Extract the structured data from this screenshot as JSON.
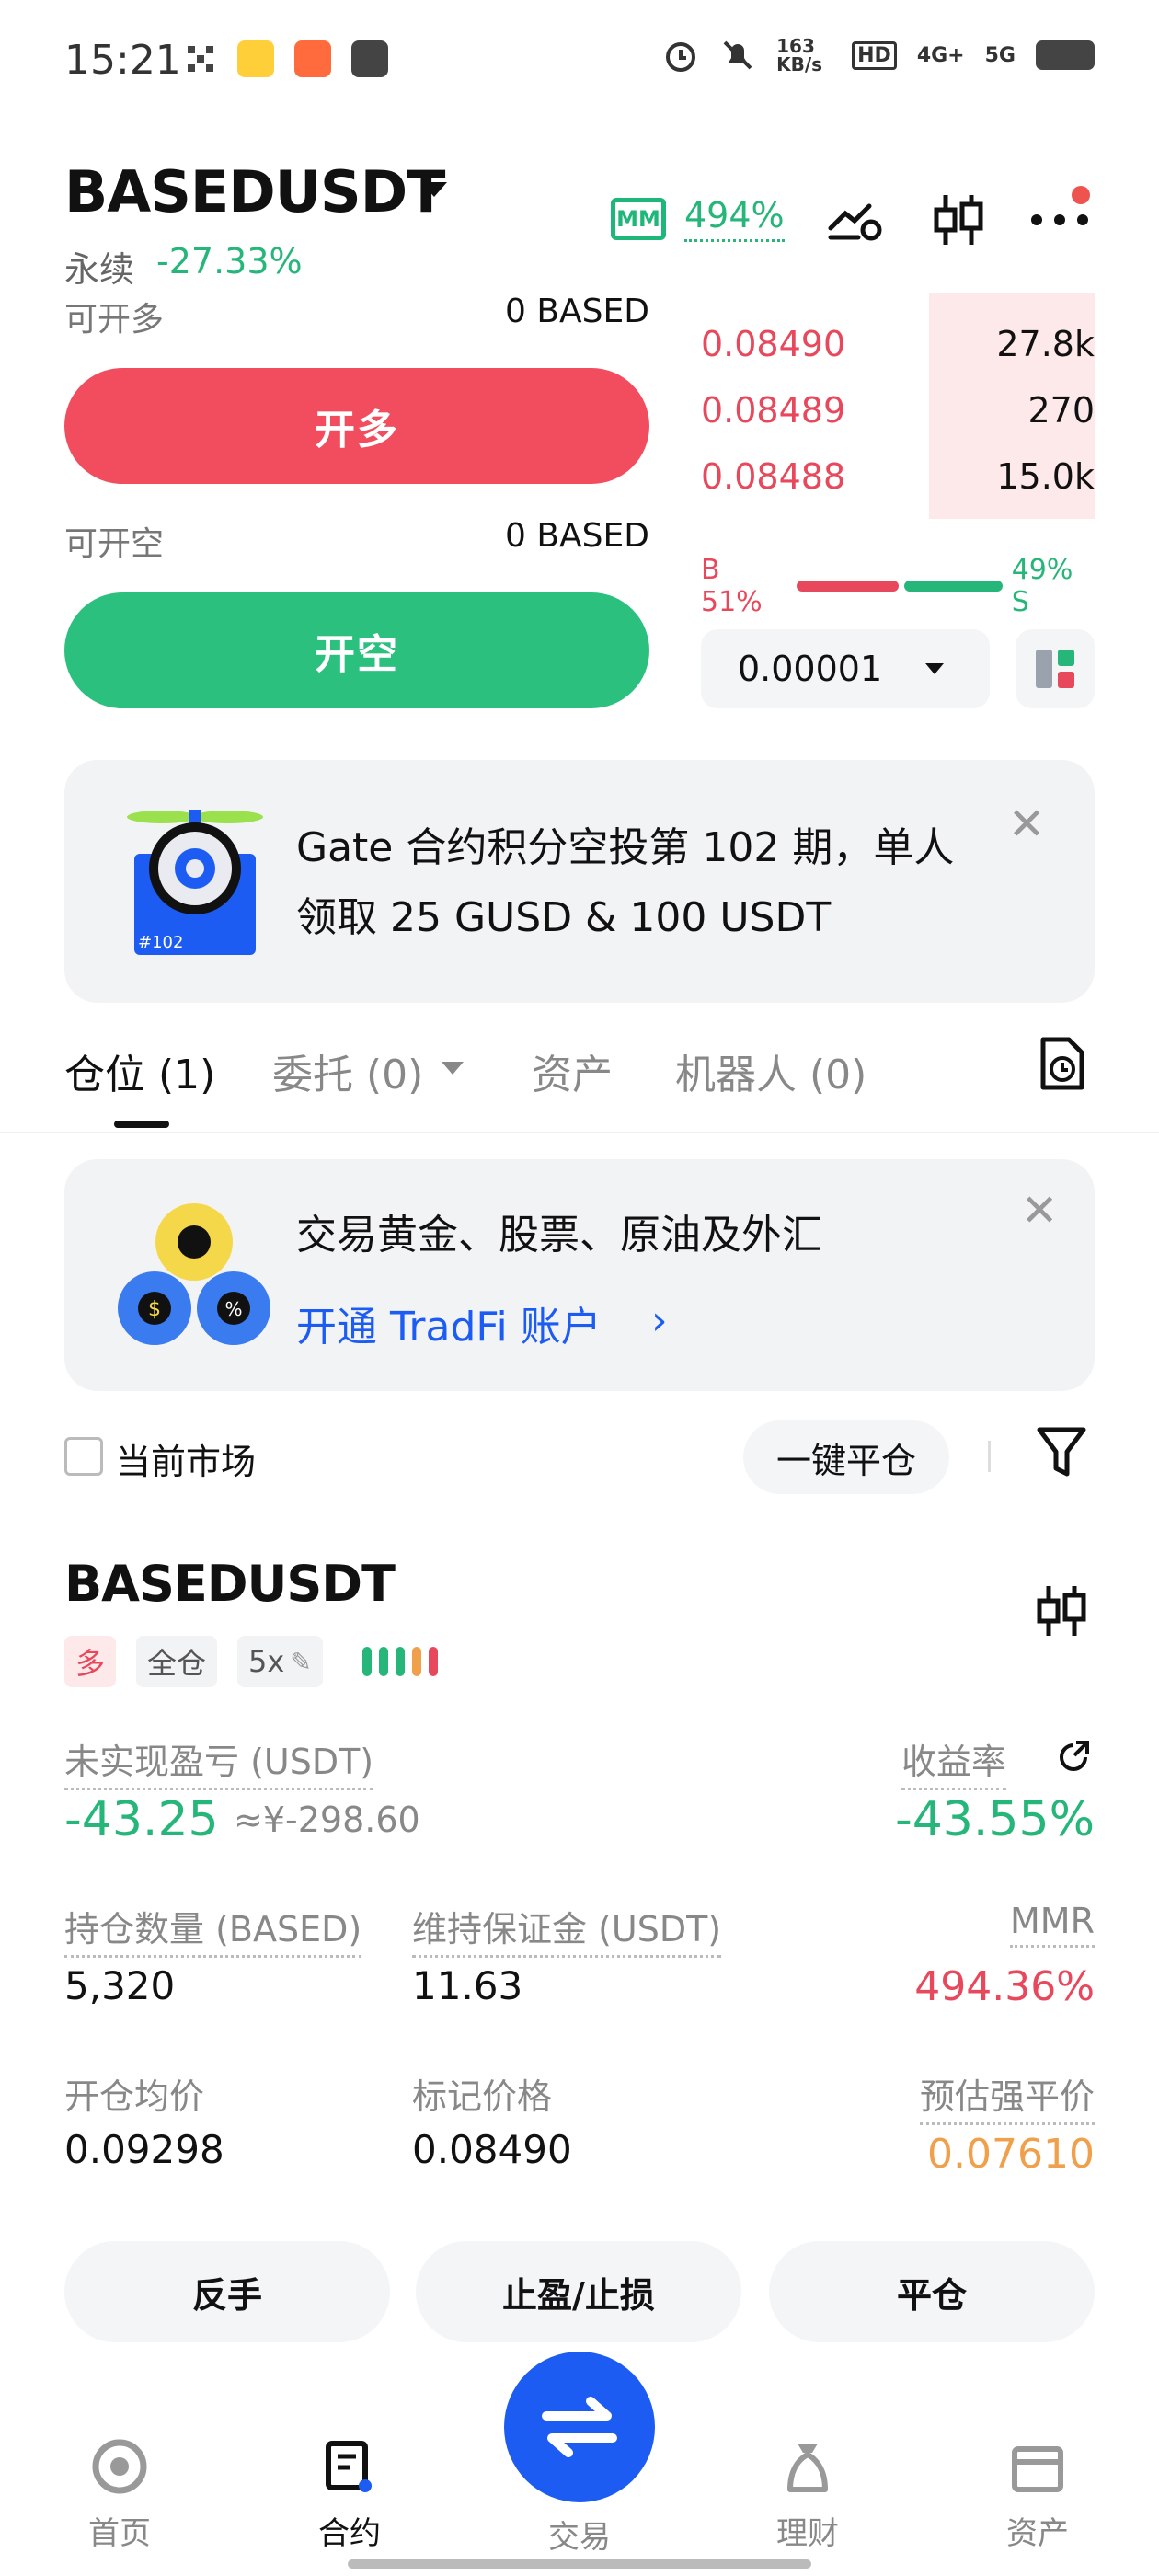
{
  "status_bar": {
    "time": "15:21",
    "speed": "163 KB/s",
    "network1": "4G+",
    "network2": "5G"
  },
  "header": {
    "pair": "BASEDUSDT",
    "contract_type": "永续",
    "change": "-27.33%",
    "mm_label": "MM",
    "mm_value": "494%"
  },
  "trade_panel": {
    "long_avail_label": "可开多",
    "long_avail_value": "0 BASED",
    "long_button": "开多",
    "short_avail_label": "可开空",
    "short_avail_value": "0 BASED",
    "short_button": "开空"
  },
  "orderbook": {
    "asks": [
      {
        "price": "0.08490",
        "size": "27.8k",
        "depth": 0.24
      },
      {
        "price": "0.08489",
        "size": "270",
        "depth": 0.24
      },
      {
        "price": "0.08488",
        "size": "15.0k",
        "depth": 0.26
      }
    ],
    "buy_ratio_label": "B 51%",
    "sell_ratio_label": "49% S",
    "buy_ratio": 0.51,
    "sell_ratio": 0.49,
    "precision": "0.00001"
  },
  "banner1": {
    "text": "Gate 合约积分空投第 102 期，单人领取 25 GUSD & 100 USDT",
    "badge": "#102"
  },
  "tabs": [
    {
      "label": "仓位 (1)"
    },
    {
      "label": "委托 (0)"
    },
    {
      "label": "资产"
    },
    {
      "label": "机器人 (0)"
    }
  ],
  "banner2": {
    "title": "交易黄金、股票、原油及外汇",
    "link": "开通 TradFi 账户"
  },
  "filters": {
    "current_market": "当前市场",
    "close_all": "一键平仓"
  },
  "position": {
    "pair": "BASEDUSDT",
    "side_tag": "多",
    "margin_tag": "全仓",
    "leverage_tag": "5x",
    "unrealized_label": "未实现盈亏 (USDT)",
    "unrealized_value": "-43.25",
    "unrealized_cny": "≈¥-298.60",
    "roe_label": "收益率",
    "roe_value": "-43.55%",
    "size_label": "持仓数量 (BASED)",
    "size_value": "5,320",
    "maint_margin_label": "维持保证金 (USDT)",
    "maint_margin_value": "11.63",
    "mmr_label": "MMR",
    "mmr_value": "494.36%",
    "entry_label": "开仓均价",
    "entry_value": "0.09298",
    "mark_label": "标记价格",
    "mark_value": "0.08490",
    "liq_label": "预估强平价",
    "liq_value": "0.07610",
    "btn_reverse": "反手",
    "btn_tpsl": "止盈/止损",
    "btn_close": "平仓"
  },
  "bottom_nav": [
    {
      "label": "首页"
    },
    {
      "label": "合约"
    },
    {
      "label": "交易"
    },
    {
      "label": "理财"
    },
    {
      "label": "资产"
    }
  ],
  "colors": {
    "green": "#26b67a",
    "red": "#e8485c",
    "orange": "#f0a04b",
    "blue": "#1c5cf2"
  }
}
